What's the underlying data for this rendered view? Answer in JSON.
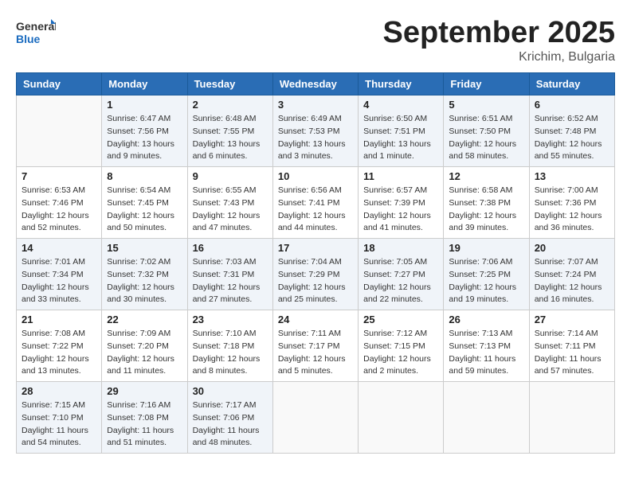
{
  "logo": {
    "general": "General",
    "blue": "Blue"
  },
  "title": "September 2025",
  "location": "Krichim, Bulgaria",
  "days_of_week": [
    "Sunday",
    "Monday",
    "Tuesday",
    "Wednesday",
    "Thursday",
    "Friday",
    "Saturday"
  ],
  "weeks": [
    [
      {
        "day": "",
        "sunrise": "",
        "sunset": "",
        "daylight": ""
      },
      {
        "day": "1",
        "sunrise": "Sunrise: 6:47 AM",
        "sunset": "Sunset: 7:56 PM",
        "daylight": "Daylight: 13 hours and 9 minutes."
      },
      {
        "day": "2",
        "sunrise": "Sunrise: 6:48 AM",
        "sunset": "Sunset: 7:55 PM",
        "daylight": "Daylight: 13 hours and 6 minutes."
      },
      {
        "day": "3",
        "sunrise": "Sunrise: 6:49 AM",
        "sunset": "Sunset: 7:53 PM",
        "daylight": "Daylight: 13 hours and 3 minutes."
      },
      {
        "day": "4",
        "sunrise": "Sunrise: 6:50 AM",
        "sunset": "Sunset: 7:51 PM",
        "daylight": "Daylight: 13 hours and 1 minute."
      },
      {
        "day": "5",
        "sunrise": "Sunrise: 6:51 AM",
        "sunset": "Sunset: 7:50 PM",
        "daylight": "Daylight: 12 hours and 58 minutes."
      },
      {
        "day": "6",
        "sunrise": "Sunrise: 6:52 AM",
        "sunset": "Sunset: 7:48 PM",
        "daylight": "Daylight: 12 hours and 55 minutes."
      }
    ],
    [
      {
        "day": "7",
        "sunrise": "Sunrise: 6:53 AM",
        "sunset": "Sunset: 7:46 PM",
        "daylight": "Daylight: 12 hours and 52 minutes."
      },
      {
        "day": "8",
        "sunrise": "Sunrise: 6:54 AM",
        "sunset": "Sunset: 7:45 PM",
        "daylight": "Daylight: 12 hours and 50 minutes."
      },
      {
        "day": "9",
        "sunrise": "Sunrise: 6:55 AM",
        "sunset": "Sunset: 7:43 PM",
        "daylight": "Daylight: 12 hours and 47 minutes."
      },
      {
        "day": "10",
        "sunrise": "Sunrise: 6:56 AM",
        "sunset": "Sunset: 7:41 PM",
        "daylight": "Daylight: 12 hours and 44 minutes."
      },
      {
        "day": "11",
        "sunrise": "Sunrise: 6:57 AM",
        "sunset": "Sunset: 7:39 PM",
        "daylight": "Daylight: 12 hours and 41 minutes."
      },
      {
        "day": "12",
        "sunrise": "Sunrise: 6:58 AM",
        "sunset": "Sunset: 7:38 PM",
        "daylight": "Daylight: 12 hours and 39 minutes."
      },
      {
        "day": "13",
        "sunrise": "Sunrise: 7:00 AM",
        "sunset": "Sunset: 7:36 PM",
        "daylight": "Daylight: 12 hours and 36 minutes."
      }
    ],
    [
      {
        "day": "14",
        "sunrise": "Sunrise: 7:01 AM",
        "sunset": "Sunset: 7:34 PM",
        "daylight": "Daylight: 12 hours and 33 minutes."
      },
      {
        "day": "15",
        "sunrise": "Sunrise: 7:02 AM",
        "sunset": "Sunset: 7:32 PM",
        "daylight": "Daylight: 12 hours and 30 minutes."
      },
      {
        "day": "16",
        "sunrise": "Sunrise: 7:03 AM",
        "sunset": "Sunset: 7:31 PM",
        "daylight": "Daylight: 12 hours and 27 minutes."
      },
      {
        "day": "17",
        "sunrise": "Sunrise: 7:04 AM",
        "sunset": "Sunset: 7:29 PM",
        "daylight": "Daylight: 12 hours and 25 minutes."
      },
      {
        "day": "18",
        "sunrise": "Sunrise: 7:05 AM",
        "sunset": "Sunset: 7:27 PM",
        "daylight": "Daylight: 12 hours and 22 minutes."
      },
      {
        "day": "19",
        "sunrise": "Sunrise: 7:06 AM",
        "sunset": "Sunset: 7:25 PM",
        "daylight": "Daylight: 12 hours and 19 minutes."
      },
      {
        "day": "20",
        "sunrise": "Sunrise: 7:07 AM",
        "sunset": "Sunset: 7:24 PM",
        "daylight": "Daylight: 12 hours and 16 minutes."
      }
    ],
    [
      {
        "day": "21",
        "sunrise": "Sunrise: 7:08 AM",
        "sunset": "Sunset: 7:22 PM",
        "daylight": "Daylight: 12 hours and 13 minutes."
      },
      {
        "day": "22",
        "sunrise": "Sunrise: 7:09 AM",
        "sunset": "Sunset: 7:20 PM",
        "daylight": "Daylight: 12 hours and 11 minutes."
      },
      {
        "day": "23",
        "sunrise": "Sunrise: 7:10 AM",
        "sunset": "Sunset: 7:18 PM",
        "daylight": "Daylight: 12 hours and 8 minutes."
      },
      {
        "day": "24",
        "sunrise": "Sunrise: 7:11 AM",
        "sunset": "Sunset: 7:17 PM",
        "daylight": "Daylight: 12 hours and 5 minutes."
      },
      {
        "day": "25",
        "sunrise": "Sunrise: 7:12 AM",
        "sunset": "Sunset: 7:15 PM",
        "daylight": "Daylight: 12 hours and 2 minutes."
      },
      {
        "day": "26",
        "sunrise": "Sunrise: 7:13 AM",
        "sunset": "Sunset: 7:13 PM",
        "daylight": "Daylight: 11 hours and 59 minutes."
      },
      {
        "day": "27",
        "sunrise": "Sunrise: 7:14 AM",
        "sunset": "Sunset: 7:11 PM",
        "daylight": "Daylight: 11 hours and 57 minutes."
      }
    ],
    [
      {
        "day": "28",
        "sunrise": "Sunrise: 7:15 AM",
        "sunset": "Sunset: 7:10 PM",
        "daylight": "Daylight: 11 hours and 54 minutes."
      },
      {
        "day": "29",
        "sunrise": "Sunrise: 7:16 AM",
        "sunset": "Sunset: 7:08 PM",
        "daylight": "Daylight: 11 hours and 51 minutes."
      },
      {
        "day": "30",
        "sunrise": "Sunrise: 7:17 AM",
        "sunset": "Sunset: 7:06 PM",
        "daylight": "Daylight: 11 hours and 48 minutes."
      },
      {
        "day": "",
        "sunrise": "",
        "sunset": "",
        "daylight": ""
      },
      {
        "day": "",
        "sunrise": "",
        "sunset": "",
        "daylight": ""
      },
      {
        "day": "",
        "sunrise": "",
        "sunset": "",
        "daylight": ""
      },
      {
        "day": "",
        "sunrise": "",
        "sunset": "",
        "daylight": ""
      }
    ]
  ]
}
